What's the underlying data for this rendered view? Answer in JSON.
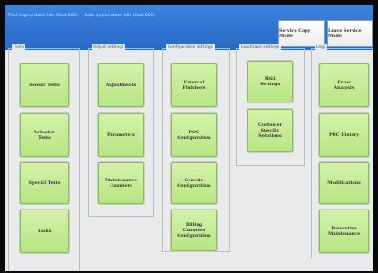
{
  "header": {
    "status_text": "Print engine state: Idle (Cold SOS) --- Scan engine state: Idle (Cold SOS)",
    "service_copy_mode_label": "Service Copy Mode",
    "leave_service_mode_label": "Leave Service Mode"
  },
  "groups": {
    "tests": {
      "title": "Tests",
      "buttons": [
        "Sensor Tests",
        "Actuator\nTests",
        "Special Tests",
        "Tasks"
      ]
    },
    "adjust": {
      "title": "Adjust settings",
      "buttons": [
        "Adjustments",
        "Parameters",
        "Maintenance\nCounters"
      ]
    },
    "configuration": {
      "title": "Configuration settings",
      "buttons": [
        "External\nFinishers",
        "POC\nConfiguration",
        "Generic\nConfiguration",
        "Billing\nCounters\nConfiguration"
      ]
    },
    "loadsave": {
      "title": "Load/save settings",
      "buttons": [
        "M&L\nSettings",
        "Customer\nSpecific\nSolutions"
      ]
    },
    "logs": {
      "title": "Logs",
      "buttons": [
        "Error\nAnalysis",
        "POC History",
        "Modifications",
        "Preventive\nMaintenance"
      ]
    }
  }
}
